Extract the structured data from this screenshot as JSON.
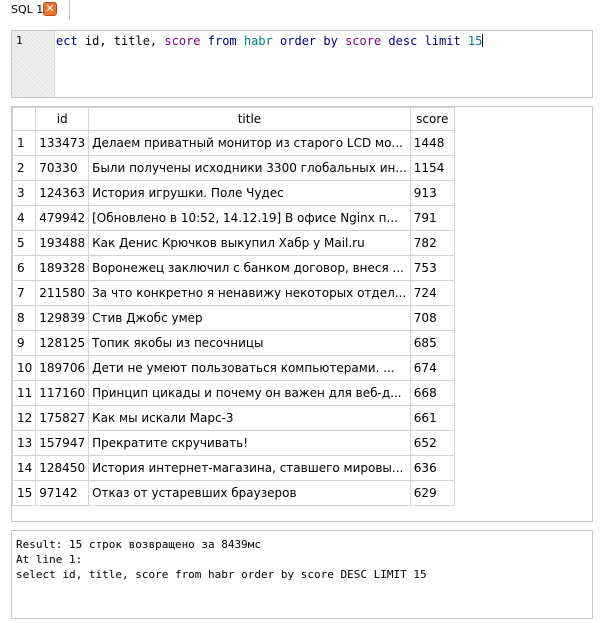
{
  "tabs": [
    {
      "label": "SQL 1",
      "close_glyph": "✕"
    }
  ],
  "editor": {
    "line_number": "1",
    "tokens": {
      "t1": "ect",
      "t2": " id, title, ",
      "t3": "score",
      "t4": " ",
      "t5": "from",
      "t6": " ",
      "t7": "habr",
      "t8": " ",
      "t9": "order by",
      "t10": " ",
      "t11": "score",
      "t12": " ",
      "t13": "desc limit",
      "t14": " ",
      "t15": "15"
    }
  },
  "grid": {
    "columns": [
      "id",
      "title",
      "score"
    ],
    "rows": [
      {
        "n": "1",
        "id": "133473",
        "title": "Делаем приватный монитор из старого LCD мо...",
        "score": "1448"
      },
      {
        "n": "2",
        "id": "70330",
        "title": "Были получены исходники 3300 глобальных ин...",
        "score": "1154"
      },
      {
        "n": "3",
        "id": "124363",
        "title": "История игрушки. Поле Чудес",
        "score": "913"
      },
      {
        "n": "4",
        "id": "479942",
        "title": "[Обновлено в 10:52, 14.12.19] В офисе Nginx п...",
        "score": "791"
      },
      {
        "n": "5",
        "id": "193488",
        "title": "Как Денис Крючков выкупил Хабр у Mail.ru",
        "score": "782"
      },
      {
        "n": "6",
        "id": "189328",
        "title": "Воронежец заключил с банком договор, внеся ...",
        "score": "753"
      },
      {
        "n": "7",
        "id": "211580",
        "title": "За что конкретно я ненавижу некоторых отдел...",
        "score": "724"
      },
      {
        "n": "8",
        "id": "129839",
        "title": "Стив Джобс умер",
        "score": "708"
      },
      {
        "n": "9",
        "id": "128125",
        "title": "Топик якобы из песочницы",
        "score": "685"
      },
      {
        "n": "10",
        "id": "189706",
        "title": "Дети не умеют пользоваться компьютерами. ...",
        "score": "674"
      },
      {
        "n": "11",
        "id": "117160",
        "title": "Принцип цикады и почему он важен для веб-д...",
        "score": "668"
      },
      {
        "n": "12",
        "id": "175827",
        "title": "Как мы искали Марс-3",
        "score": "661"
      },
      {
        "n": "13",
        "id": "157947",
        "title": "Прекратите скручивать!",
        "score": "652"
      },
      {
        "n": "14",
        "id": "128450",
        "title": "История интернет-магазина, ставшего мировы...",
        "score": "636"
      },
      {
        "n": "15",
        "id": "97142",
        "title": "Отказ от устаревших браузеров",
        "score": "629"
      }
    ]
  },
  "result": {
    "lines": [
      "Result: 15 строк возвращено за 8439мс",
      "At line 1:",
      "select id, title, score from habr order by score DESC LIMIT 15"
    ]
  }
}
